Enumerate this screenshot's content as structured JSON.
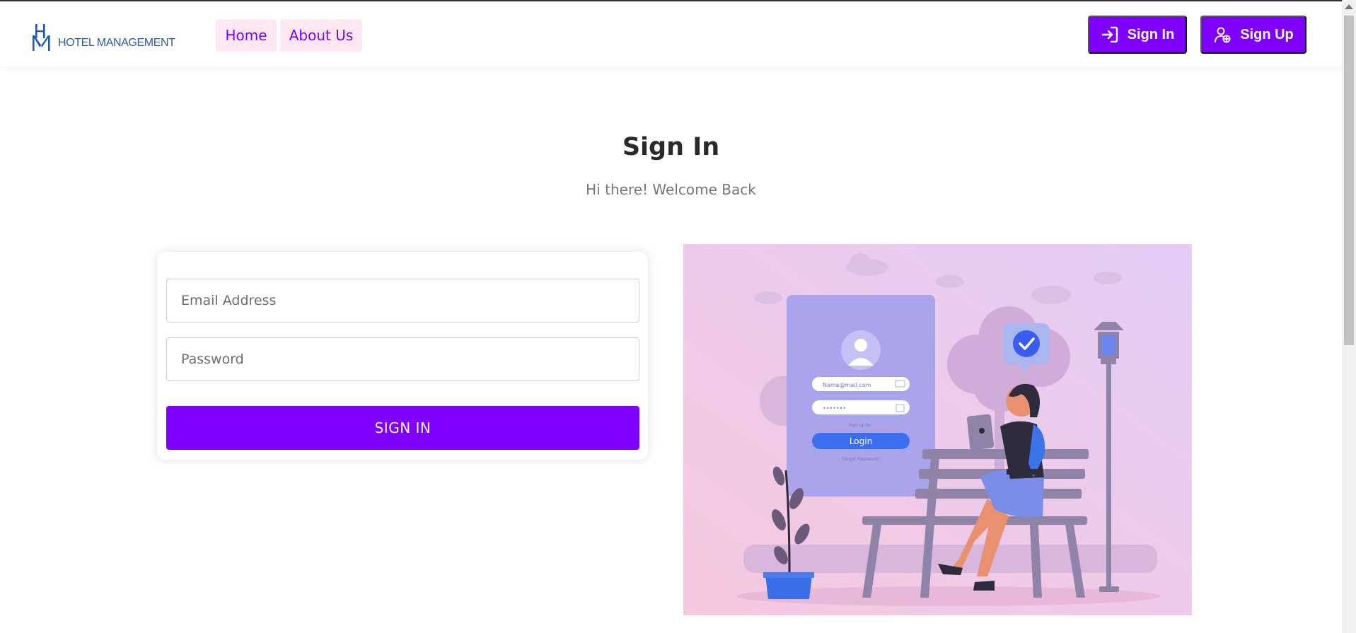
{
  "brand": {
    "logo_text": "HOTEL MANAGEMENT",
    "logo_icon": "hm-monogram-logo"
  },
  "nav": {
    "links": [
      {
        "label": "Home"
      },
      {
        "label": "About Us"
      }
    ],
    "signin_label": "Sign In",
    "signin_icon": "login-arrow-icon",
    "signup_label": "Sign Up",
    "signup_icon": "user-plus-icon"
  },
  "page": {
    "title": "Sign In",
    "subtitle": "Hi there! Welcome Back"
  },
  "form": {
    "email_placeholder": "Email Address",
    "email_value": "",
    "password_placeholder": "Password",
    "password_value": "",
    "submit_label": "SIGN IN"
  },
  "illustration": {
    "email_text": "Name@mail.com",
    "password_text": "•••••••",
    "signup_text": "Sign up for",
    "login_label": "Login",
    "forgot_text": "Forgot Password?"
  },
  "colors": {
    "accent": "#8000ff",
    "nav_bg": "#fce7f3",
    "nav_text": "#7c00ff"
  }
}
